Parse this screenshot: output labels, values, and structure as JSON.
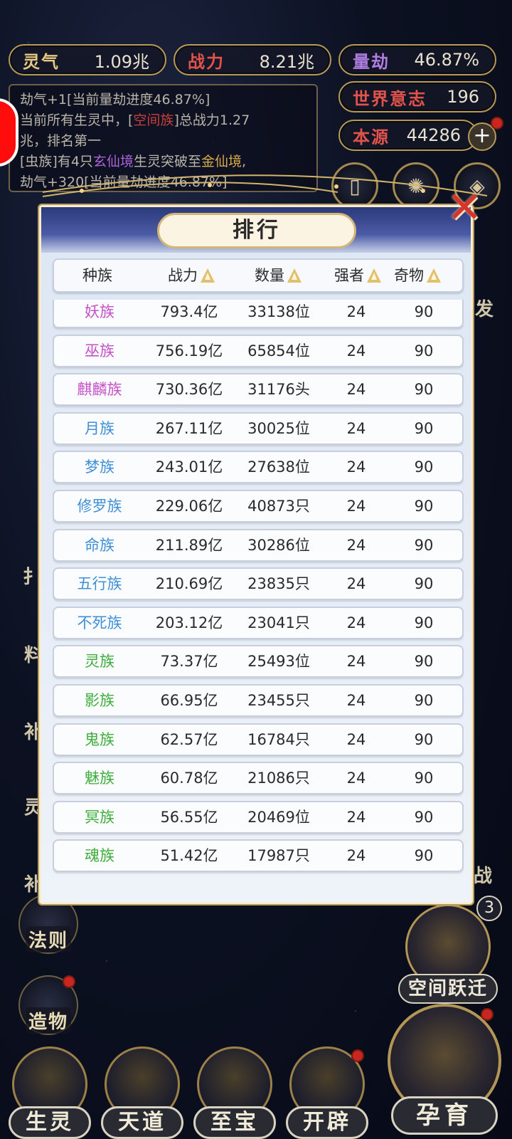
{
  "stats": {
    "lingqi": {
      "label": "灵气",
      "value": "1.09兆"
    },
    "zhanli": {
      "label": "战力",
      "value": "8.21兆"
    },
    "liangjie": {
      "label": "量劫",
      "value": "46.87%"
    },
    "world_will": {
      "label": "世界意志",
      "value": "196"
    },
    "benyuan": {
      "label": "本源",
      "value": "44286"
    }
  },
  "log": {
    "line1": "劫气+1[当前量劫进度46.87%]",
    "line2_a": "当前所有生灵中，[",
    "line2_highlight": "空间族",
    "line2_b": "]总战力1.27",
    "line3": "兆，排名第一",
    "line4_a": "[虫族]有4只",
    "line4_purple": "玄仙境",
    "line4_b": "生灵突破至",
    "line4_gold": "金仙境",
    "line4_c": ",",
    "line5": "劫气+320[当前量劫进度46.87%]"
  },
  "panel": {
    "title": "排行",
    "close_label": "✕",
    "headers": {
      "race": "种族",
      "power": "战力",
      "count": "数量",
      "strong": "强者",
      "item": "奇物"
    },
    "rows": [
      {
        "race": "妖族",
        "power": "793.4亿",
        "count": "33138位",
        "strong": "24",
        "item": "90",
        "color": "#c451c7"
      },
      {
        "race": "巫族",
        "power": "756.19亿",
        "count": "65854位",
        "strong": "24",
        "item": "90",
        "color": "#c451c7"
      },
      {
        "race": "麒麟族",
        "power": "730.36亿",
        "count": "31176头",
        "strong": "24",
        "item": "90",
        "color": "#c451c7"
      },
      {
        "race": "月族",
        "power": "267.11亿",
        "count": "30025位",
        "strong": "24",
        "item": "90",
        "color": "#3f8fd6"
      },
      {
        "race": "梦族",
        "power": "243.01亿",
        "count": "27638位",
        "strong": "24",
        "item": "90",
        "color": "#3f8fd6"
      },
      {
        "race": "修罗族",
        "power": "229.06亿",
        "count": "40873只",
        "strong": "24",
        "item": "90",
        "color": "#3f8fd6"
      },
      {
        "race": "命族",
        "power": "211.89亿",
        "count": "30286位",
        "strong": "24",
        "item": "90",
        "color": "#3f8fd6"
      },
      {
        "race": "五行族",
        "power": "210.69亿",
        "count": "23835只",
        "strong": "24",
        "item": "90",
        "color": "#3f8fd6"
      },
      {
        "race": "不死族",
        "power": "203.12亿",
        "count": "23041只",
        "strong": "24",
        "item": "90",
        "color": "#3f8fd6"
      },
      {
        "race": "灵族",
        "power": "73.37亿",
        "count": "25493位",
        "strong": "24",
        "item": "90",
        "color": "#3dad3b"
      },
      {
        "race": "影族",
        "power": "66.95亿",
        "count": "23455只",
        "strong": "24",
        "item": "90",
        "color": "#3dad3b"
      },
      {
        "race": "鬼族",
        "power": "62.57亿",
        "count": "16784只",
        "strong": "24",
        "item": "90",
        "color": "#3dad3b"
      },
      {
        "race": "魅族",
        "power": "60.78亿",
        "count": "21086只",
        "strong": "24",
        "item": "90",
        "color": "#3dad3b"
      },
      {
        "race": "冥族",
        "power": "56.55亿",
        "count": "20469位",
        "strong": "24",
        "item": "90",
        "color": "#3dad3b"
      },
      {
        "race": "魂族",
        "power": "51.42亿",
        "count": "17987只",
        "strong": "24",
        "item": "90",
        "color": "#3dad3b"
      }
    ]
  },
  "side": {
    "fa_ze": "法则",
    "zao_wu": "造物",
    "right_edge_fa": "发",
    "right_edge_zhan": "战",
    "left_edge": [
      "扌",
      "料",
      "补",
      "灵",
      "补"
    ]
  },
  "space_jump": {
    "label": "空间跃迁",
    "badge": "3"
  },
  "nav": {
    "sheng_ling": "生灵",
    "tian_dao": "天道",
    "zhi_bao": "至宝",
    "kai_pi": "开辟",
    "yun_yu": "孕育"
  },
  "colors": {
    "gold_border": "#b89a55",
    "race_purple": "#c451c7",
    "race_blue": "#3f8fd6",
    "race_green": "#3dad3b",
    "close_red": "#d6342d"
  }
}
